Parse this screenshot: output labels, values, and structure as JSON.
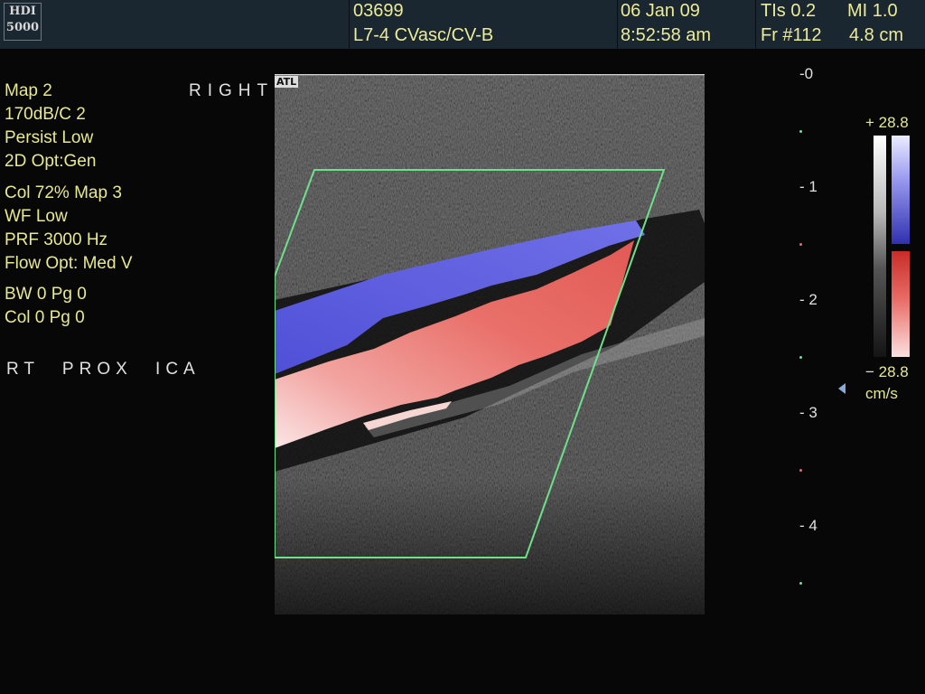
{
  "header": {
    "logo_line1": "HDI",
    "logo_line2": "5000",
    "patient_id": "03699",
    "transducer": "L7-4 CVasc/CV-B",
    "date": "06 Jan 09",
    "time": "8:52:58 am",
    "tis": "TIs 0.2",
    "mi": "MI 1.0",
    "frame": "Fr #112",
    "depth_cm": "4.8 cm"
  },
  "settings": {
    "map": "Map 2",
    "gain": "170dB/C 2",
    "persist": "Persist Low",
    "opt2d": "2D Opt:Gen",
    "col": "Col 72%  Map 3",
    "wf": "WF Low",
    "prf": "PRF 3000  Hz",
    "flow_opt": "Flow Opt: Med V",
    "bw": "BW 0     Pg 0",
    "col0": "Col 0     Pg 0"
  },
  "labels": {
    "side": "RIGHT",
    "annotation": "RT  PROX  ICA",
    "atl": "ATL"
  },
  "depth_scale": [
    "0",
    "1",
    "2",
    "3",
    "4"
  ],
  "color_scale": {
    "max": "+ 28.8",
    "min": "− 28.8",
    "unit": "cm/s"
  },
  "colors": {
    "header_bg": "#1a2630",
    "text": "#e8e88e",
    "roi_box": "#6fe08a",
    "flow_towards": "#4c4cd6",
    "flow_away": "#e86b66"
  }
}
